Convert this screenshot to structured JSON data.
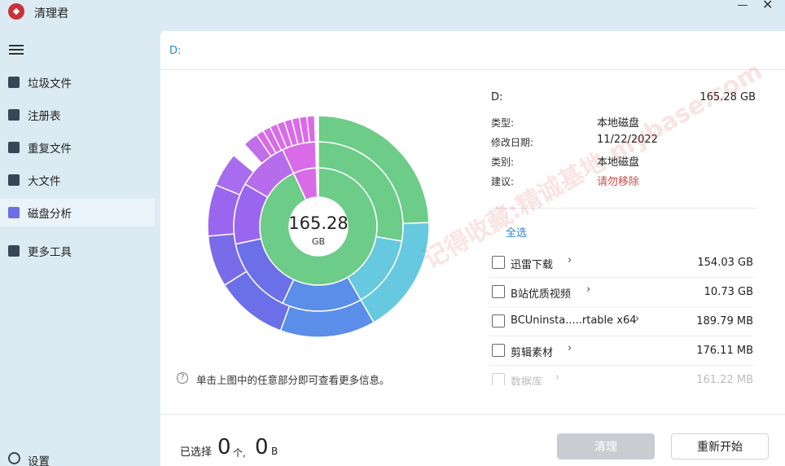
{
  "app": {
    "title": "清理君",
    "logo_icon": "app-logo-icon"
  },
  "window": {
    "minimize_icon": "minimize-icon",
    "close_icon": "close-icon",
    "close_glyph": "✕"
  },
  "sidebar": {
    "menu_icon": "hamburger-menu-icon",
    "items": [
      {
        "label": "垃圾文件",
        "icon": "trash-icon"
      },
      {
        "label": "注册表",
        "icon": "registry-icon"
      },
      {
        "label": "重复文件",
        "icon": "duplicate-files-icon"
      },
      {
        "label": "大文件",
        "icon": "large-file-icon"
      },
      {
        "label": "磁盘分析",
        "icon": "disk-icon",
        "active": true
      },
      {
        "label": "更多工具",
        "icon": "toolbox-icon"
      }
    ],
    "settings": {
      "label": "设置",
      "icon": "gear-icon"
    }
  },
  "path_bar": {
    "path": "D:"
  },
  "disk_chart": {
    "center_value": "165.28",
    "center_unit": "GB",
    "hint_icon": "help-circle-icon",
    "hint": "单击上图中的任意部分即可查看更多信息。"
  },
  "info": {
    "drive": "D:",
    "total_size": "165.28 GB",
    "rows": [
      {
        "label": "类型:",
        "value": "本地磁盘"
      },
      {
        "label": "修改日期:",
        "value": "11/22/2022"
      },
      {
        "label": "类别:",
        "value": "本地磁盘"
      },
      {
        "label": "建议:",
        "value": "请勿移除"
      }
    ]
  },
  "select_all": "全选",
  "items": [
    {
      "name": "迅雷下载",
      "size": "154.03 GB"
    },
    {
      "name": "B站优质视频",
      "size": "10.73 GB"
    },
    {
      "name": "BCUninsta.....rtable x64",
      "size": "189.79 MB"
    },
    {
      "name": "剪辑素材",
      "size": "176.11 MB"
    },
    {
      "name": "数据库",
      "size": "161.22 MB"
    }
  ],
  "chevron_glyph": "›",
  "footer": {
    "selected_prefix": "已选择",
    "selected_count": "0",
    "count_unit": "个,",
    "selected_size": "0",
    "size_unit": "B",
    "clean_button": "清理",
    "restart_button": "重新开始"
  },
  "watermark": "记得收藏:精诚基地 mybase.com",
  "colors": {
    "accent": "#2d86d4",
    "danger": "#d34a4a",
    "ring_green": "#6ccc88",
    "ring_cyan": "#66c9df",
    "ring_blue": "#5a8ee8",
    "ring_indigo": "#6b6fe8",
    "ring_purple": "#9a66ee",
    "ring_magenta": "#d96be8"
  }
}
